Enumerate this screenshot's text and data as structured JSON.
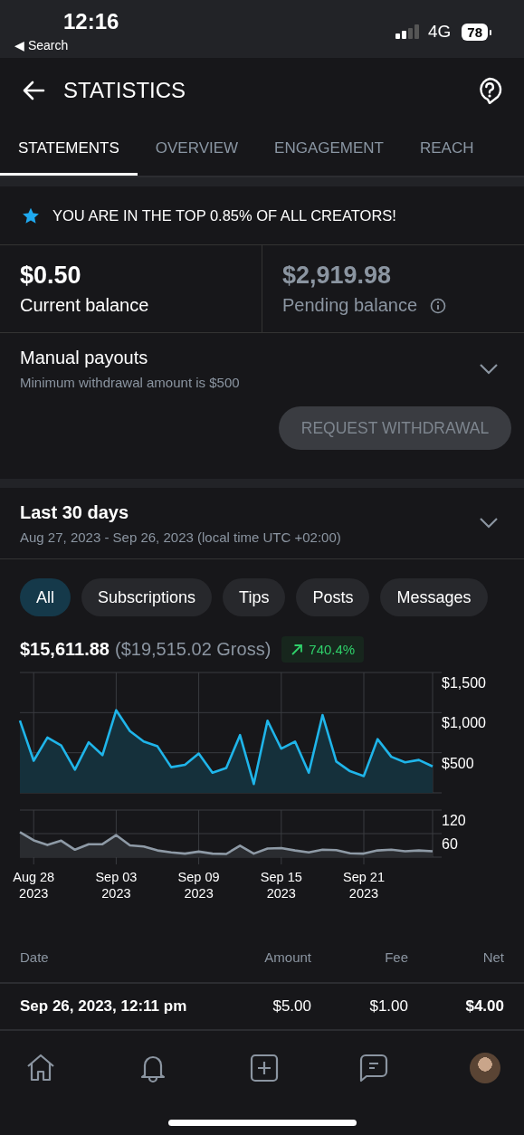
{
  "status_bar": {
    "time": "12:16",
    "back_label": "◀ Search",
    "network": "4G",
    "battery": "78"
  },
  "header": {
    "title": "STATISTICS"
  },
  "tabs": [
    {
      "label": "STATEMENTS",
      "selected": true
    },
    {
      "label": "OVERVIEW",
      "selected": false
    },
    {
      "label": "ENGAGEMENT",
      "selected": false
    },
    {
      "label": "REACH",
      "selected": false
    }
  ],
  "banner": {
    "text": "YOU ARE IN THE TOP 0.85% OF ALL CREATORS!"
  },
  "balances": [
    {
      "amount": "$0.50",
      "label": "Current balance",
      "pending": false
    },
    {
      "amount": "$2,919.98",
      "label": "Pending balance",
      "pending": true
    }
  ],
  "payouts": {
    "title": "Manual payouts",
    "subtitle": "Minimum withdrawal amount is $500",
    "expanded": false,
    "button": {
      "label": "REQUEST WITHDRAWAL",
      "disabled": true
    }
  },
  "period": {
    "title": "Last 30 days",
    "subtitle": "Aug 27, 2023 - Sep 26, 2023 (local time UTC +02:00)",
    "expanded": false
  },
  "filters": [
    {
      "label": "All",
      "selected": true
    },
    {
      "label": "Subscriptions",
      "selected": false
    },
    {
      "label": "Tips",
      "selected": false
    },
    {
      "label": "Posts",
      "selected": false
    },
    {
      "label": "Messages",
      "selected": false
    }
  ],
  "summary": {
    "net": "$15,611.88",
    "gross": "($19,515.02 Gross)",
    "change": "740.4%"
  },
  "charts": [
    {
      "chart_data": {
        "type": "area",
        "grid": true,
        "ylim": [
          0,
          1500
        ],
        "yticks": [
          {
            "value": 500,
            "label": "$500"
          },
          {
            "value": 1000,
            "label": "$1,000"
          },
          {
            "value": 1500,
            "label": "$1,500"
          }
        ],
        "series": [
          {
            "color": "#1fb5ea",
            "values": [
              900,
              400,
              690,
              590,
              290,
              630,
              470,
              1030,
              770,
              640,
              580,
              320,
              350,
              490,
              250,
              310,
              720,
              110,
              900,
              550,
              640,
              250,
              970,
              390,
              270,
              210,
              670,
              450,
              380,
              410,
              330
            ]
          }
        ]
      }
    },
    {
      "chart_data": {
        "type": "area",
        "grid": true,
        "ylim": [
          0,
          120
        ],
        "yticks": [
          60,
          120
        ],
        "categories": [
          null,
          "Aug 28 2023",
          null,
          null,
          null,
          null,
          null,
          "Sep 03 2023",
          null,
          null,
          null,
          null,
          null,
          "Sep 09 2023",
          null,
          null,
          null,
          null,
          null,
          "Sep 15 2023",
          null,
          null,
          null,
          null,
          null,
          "Sep 21 2023",
          null,
          null,
          null,
          null,
          null
        ],
        "series": [
          {
            "color": "#8e9aa6",
            "values": [
              64,
              43,
              31,
              42,
              19,
              33,
              33,
              56,
              30,
              27,
              17,
              12,
              9,
              14,
              9,
              8,
              29,
              9,
              22,
              23,
              17,
              12,
              19,
              18,
              10,
              9,
              17,
              19,
              15,
              17,
              15
            ]
          }
        ]
      }
    }
  ],
  "table": {
    "columns": [
      "Date",
      "Amount",
      "Fee",
      "Net"
    ],
    "rows": [
      [
        "Sep 26, 2023, 12:11 pm",
        "$5.00",
        "$1.00",
        "$4.00"
      ]
    ]
  }
}
